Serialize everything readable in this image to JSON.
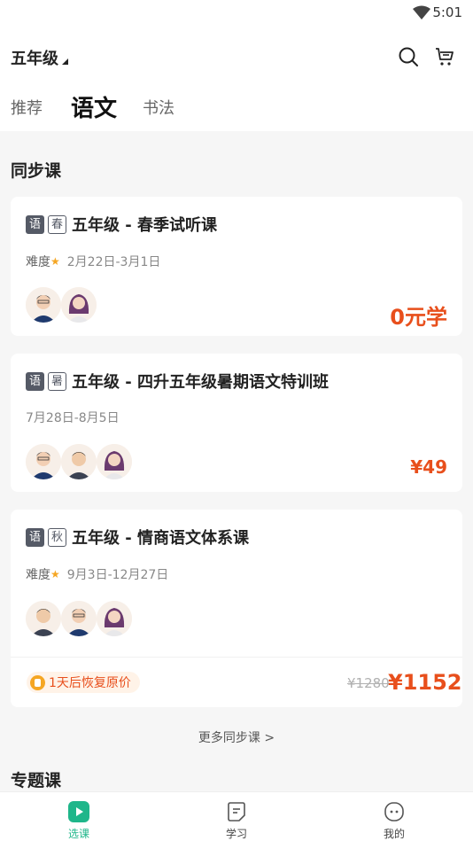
{
  "status": {
    "time": "5:01"
  },
  "header": {
    "grade": "五年级"
  },
  "tabs": [
    {
      "label": "推荐"
    },
    {
      "label": "语文"
    },
    {
      "label": "书法"
    }
  ],
  "sections": {
    "sync": "同步课",
    "special": "专题课"
  },
  "cards": [
    {
      "tag1": "语",
      "tag2": "春",
      "title": "五年级 - 春季试听课",
      "difficulty_label": "难度",
      "dates": "2月22日-3月1日",
      "price": "0元学"
    },
    {
      "tag1": "语",
      "tag2": "暑",
      "title": "五年级 - 四升五年级暑期语文特训班",
      "dates": "7月28日-8月5日",
      "price": "¥49"
    },
    {
      "tag1": "语",
      "tag2": "秋",
      "title": "五年级 - 情商语文体系课",
      "difficulty_label": "难度",
      "dates": "9月3日-12月27日",
      "promo": "1天后恢复原价",
      "old_price": "¥1280",
      "price": "¥1152"
    }
  ],
  "more_link": "更多同步课 >",
  "bottom_nav": [
    {
      "label": "选课"
    },
    {
      "label": "学习"
    },
    {
      "label": "我的"
    }
  ],
  "colors": {
    "accent": "#1fb68a",
    "price": "#e84f1c",
    "star": "#f5a623"
  },
  "icons": [
    "wifi-icon",
    "search-icon",
    "cart-icon",
    "star-icon",
    "bell-icon",
    "play-icon",
    "notes-icon",
    "face-icon"
  ]
}
